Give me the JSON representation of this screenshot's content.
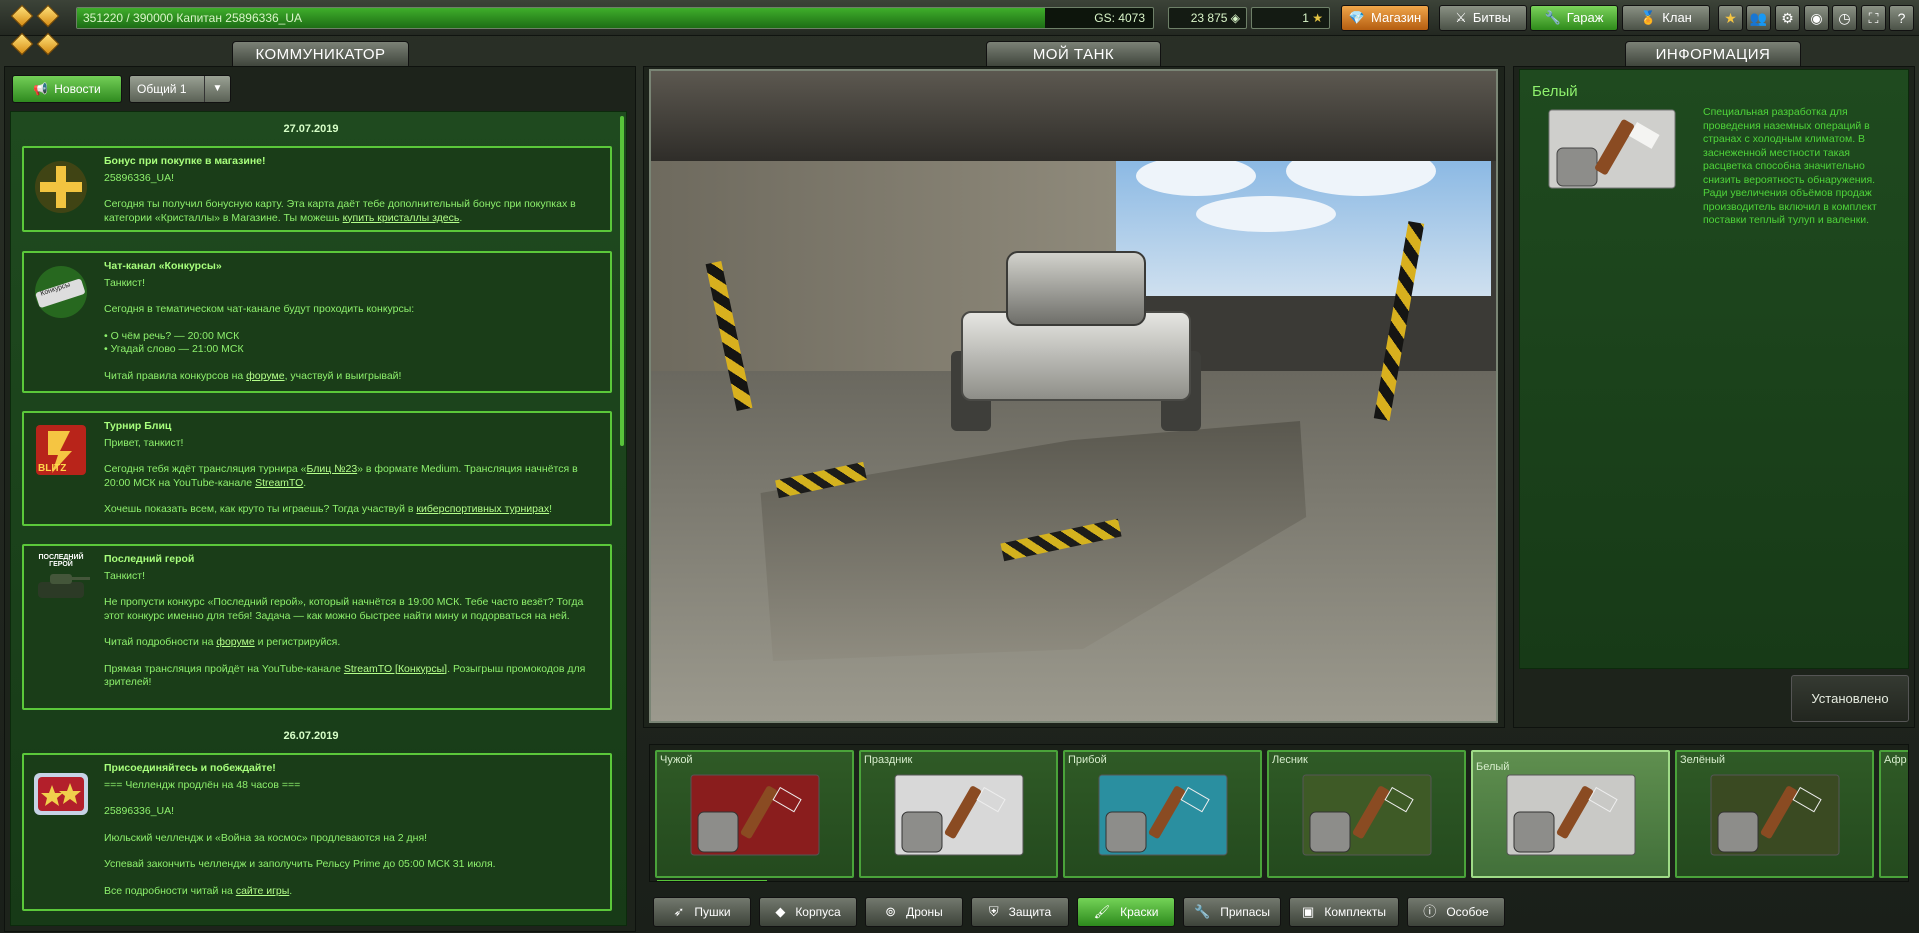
{
  "topbar": {
    "xp_text": "351220 / 390000  Капитан 25896336_UA",
    "xp_progress": 0.9,
    "gs_text": "GS: 4073",
    "crystals": "23 875",
    "crystals_icon": "diamond-icon",
    "stars": "1",
    "nav": {
      "shop": "Магазин",
      "battles": "Битвы",
      "garage": "Гараж",
      "clan": "Клан"
    },
    "icons": [
      "star-icon",
      "friends-icon",
      "settings-icon",
      "sound-icon",
      "clock-icon",
      "fullscreen-icon",
      "help-icon"
    ],
    "help_glyph": "?"
  },
  "headers": {
    "communicator": "КОММУНИКАТОР",
    "my_tank": "МОЙ ТАНК",
    "info": "ИНФОРМАЦИЯ"
  },
  "communicator": {
    "news_button": "Новости",
    "channel_select": "Общий 1",
    "dates": [
      "27.07.2019",
      "26.07.2019"
    ],
    "messages": [
      {
        "title": "Бонус при покупке в магазине!",
        "lines": [
          "25896336_UA!"
        ],
        "text_before": "Сегодня ты получил бонусную карту. Эта карта даёт тебе дополнительный бонус при покупках в категории «Кристаллы» в Магазине. Ты можешь ",
        "link": "купить кристаллы здесь",
        "text_after": "."
      },
      {
        "title": "Чат-канал «Конкурсы»",
        "thumb_label": "Конкурсы",
        "greeting": "Танкист!",
        "p1": "Сегодня в тематическом чат-канале будут проходить конкурсы:",
        "bullet1": "• О чём речь? — 20:00 МСК",
        "bullet2": "• Угадай слово — 21:00 МСК",
        "p3_before": "Читай правила конкурсов на ",
        "p3_link": "форуме",
        "p3_after": ", участвуй и выигрывай!"
      },
      {
        "title": "Турнир Блиц",
        "thumb_label": "BLITZ",
        "greeting": "Привет, танкист!",
        "p1_before": " Сегодня тебя ждёт трансляция турнира  «",
        "p1_link1": "Блиц №23",
        "p1_mid": "»  в формате Medium. Трансляция начнётся в 20:00 МСК на YouTube-канале ",
        "p1_link2": "StreamTO",
        "p1_after": ".",
        "p2_before": "Хочешь показать всем, как круто ты играешь? Тогда участвуй в ",
        "p2_link": "киберспортивных турнирах",
        "p2_after": "!"
      },
      {
        "title": "Последний герой",
        "thumb_label": "ПОСЛЕДНИЙ ГЕРОЙ",
        "greeting": "Танкист!",
        "p1": "Не пропусти конкурс «Последний герой», который начнётся в 19:00 МСК. Тебе часто везёт? Тогда этот конкурс именно для тебя! Задача — как можно быстрее найти мину и подорваться на ней.",
        "p2_before": "Читай подробности на  ",
        "p2_link": "форуме",
        "p2_after": "  и регистрируйся.",
        "p3_before": "Прямая трансляция пройдёт на YouTube-канале ",
        "p3_link": "StreamTO [Конкурсы]",
        "p3_after": ". Розыгрыш промокодов для зрителей!"
      },
      {
        "title": "Присоединяйтесь и побеждайте!",
        "l1": "=== Челлендж продлён на 48 часов ===",
        "l2": "25896336_UA!",
        "l3": "Июльский челлендж и «Война за космос» продлеваются на 2 дня!",
        "l4": "Успевай закончить челлендж и заполучить Рельсу Prime до 05:00 МСК 31 июля.",
        "l5_before": "Все подробности читай на  ",
        "l5_link": "сайте игры",
        "l5_after": "."
      }
    ]
  },
  "info": {
    "title": "Белый",
    "description": "Специальная разработка для проведения наземных операций в странах с холодным климатом. В заснеженной местности такая расцветка способна значительно снизить вероятность обнаружения. Ради увеличения объёмов продаж производитель включил в комплект поставки теплый тулуп и валенки.",
    "installed_button": "Установлено"
  },
  "paints": [
    {
      "name": "Чужой",
      "color": "#8a1d1d"
    },
    {
      "name": "Праздник",
      "color": "#d8d8d8"
    },
    {
      "name": "Прибой",
      "color": "#2a8fa0"
    },
    {
      "name": "Лесник",
      "color": "#3e5a26"
    },
    {
      "name": "Белый",
      "color": "#c9c9c6",
      "selected": true
    },
    {
      "name": "Зелёный",
      "color": "#3a4a22"
    },
    {
      "name": "Афр",
      "color": "#6a5a30"
    }
  ],
  "categories": [
    {
      "label": "Пушки",
      "icon": "gun-icon"
    },
    {
      "label": "Корпуса",
      "icon": "hull-icon"
    },
    {
      "label": "Дроны",
      "icon": "drone-icon"
    },
    {
      "label": "Защита",
      "icon": "shield-icon"
    },
    {
      "label": "Краски",
      "icon": "paint-icon",
      "active": true
    },
    {
      "label": "Припасы",
      "icon": "supplies-icon"
    },
    {
      "label": "Комплекты",
      "icon": "kits-icon"
    },
    {
      "label": "Особое",
      "icon": "special-icon"
    }
  ]
}
